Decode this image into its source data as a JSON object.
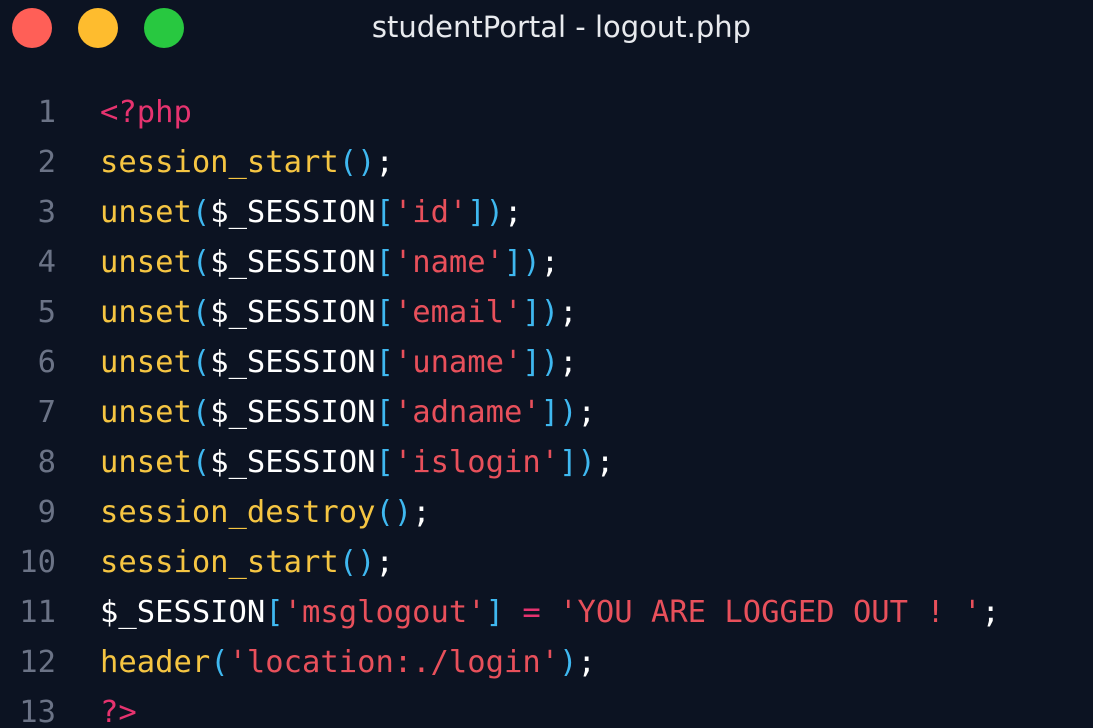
{
  "window": {
    "title": "studentPortal - logout.php",
    "buttons": [
      {
        "name": "close",
        "color": "#ff5f57"
      },
      {
        "name": "minimize",
        "color": "#febc2e"
      },
      {
        "name": "maximize",
        "color": "#28c840"
      }
    ]
  },
  "colors": {
    "keyword_tag": "#e6336f",
    "function": "#f5c542",
    "paren": "#3fb8f0",
    "default": "#ffffff",
    "string": "#e8505b",
    "operator": "#e6336f",
    "line_number": "#6b7386",
    "background": "#0c1322"
  },
  "code": {
    "lines": [
      {
        "number": "1",
        "tokens": [
          {
            "t": "<?php",
            "k": "tag"
          }
        ]
      },
      {
        "number": "2",
        "tokens": [
          {
            "t": "session_start",
            "k": "function"
          },
          {
            "t": "()",
            "k": "paren"
          },
          {
            "t": ";",
            "k": "default"
          }
        ]
      },
      {
        "number": "3",
        "tokens": [
          {
            "t": "unset",
            "k": "function"
          },
          {
            "t": "(",
            "k": "paren"
          },
          {
            "t": "$_SESSION",
            "k": "default"
          },
          {
            "t": "[",
            "k": "paren"
          },
          {
            "t": "'id'",
            "k": "string"
          },
          {
            "t": "])",
            "k": "paren"
          },
          {
            "t": ";",
            "k": "default"
          }
        ]
      },
      {
        "number": "4",
        "tokens": [
          {
            "t": "unset",
            "k": "function"
          },
          {
            "t": "(",
            "k": "paren"
          },
          {
            "t": "$_SESSION",
            "k": "default"
          },
          {
            "t": "[",
            "k": "paren"
          },
          {
            "t": "'name'",
            "k": "string"
          },
          {
            "t": "])",
            "k": "paren"
          },
          {
            "t": ";",
            "k": "default"
          }
        ]
      },
      {
        "number": "5",
        "tokens": [
          {
            "t": "unset",
            "k": "function"
          },
          {
            "t": "(",
            "k": "paren"
          },
          {
            "t": "$_SESSION",
            "k": "default"
          },
          {
            "t": "[",
            "k": "paren"
          },
          {
            "t": "'email'",
            "k": "string"
          },
          {
            "t": "])",
            "k": "paren"
          },
          {
            "t": ";",
            "k": "default"
          }
        ]
      },
      {
        "number": "6",
        "tokens": [
          {
            "t": "unset",
            "k": "function"
          },
          {
            "t": "(",
            "k": "paren"
          },
          {
            "t": "$_SESSION",
            "k": "default"
          },
          {
            "t": "[",
            "k": "paren"
          },
          {
            "t": "'uname'",
            "k": "string"
          },
          {
            "t": "])",
            "k": "paren"
          },
          {
            "t": ";",
            "k": "default"
          }
        ]
      },
      {
        "number": "7",
        "tokens": [
          {
            "t": "unset",
            "k": "function"
          },
          {
            "t": "(",
            "k": "paren"
          },
          {
            "t": "$_SESSION",
            "k": "default"
          },
          {
            "t": "[",
            "k": "paren"
          },
          {
            "t": "'adname'",
            "k": "string"
          },
          {
            "t": "])",
            "k": "paren"
          },
          {
            "t": ";",
            "k": "default"
          }
        ]
      },
      {
        "number": "8",
        "tokens": [
          {
            "t": "unset",
            "k": "function"
          },
          {
            "t": "(",
            "k": "paren"
          },
          {
            "t": "$_SESSION",
            "k": "default"
          },
          {
            "t": "[",
            "k": "paren"
          },
          {
            "t": "'islogin'",
            "k": "string"
          },
          {
            "t": "])",
            "k": "paren"
          },
          {
            "t": ";",
            "k": "default"
          }
        ]
      },
      {
        "number": "9",
        "tokens": [
          {
            "t": "session_destroy",
            "k": "function"
          },
          {
            "t": "()",
            "k": "paren"
          },
          {
            "t": ";",
            "k": "default"
          }
        ]
      },
      {
        "number": "10",
        "tokens": [
          {
            "t": "session_start",
            "k": "function"
          },
          {
            "t": "()",
            "k": "paren"
          },
          {
            "t": ";",
            "k": "default"
          }
        ]
      },
      {
        "number": "11",
        "tokens": [
          {
            "t": "$_SESSION",
            "k": "default"
          },
          {
            "t": "[",
            "k": "paren"
          },
          {
            "t": "'msglogout'",
            "k": "string"
          },
          {
            "t": "]",
            "k": "paren"
          },
          {
            "t": " ",
            "k": "default"
          },
          {
            "t": "=",
            "k": "operator"
          },
          {
            "t": " ",
            "k": "default"
          },
          {
            "t": "'YOU ARE LOGGED OUT ! '",
            "k": "string"
          },
          {
            "t": ";",
            "k": "default"
          }
        ]
      },
      {
        "number": "12",
        "tokens": [
          {
            "t": "header",
            "k": "function"
          },
          {
            "t": "(",
            "k": "paren"
          },
          {
            "t": "'location:./login'",
            "k": "string"
          },
          {
            "t": ")",
            "k": "paren"
          },
          {
            "t": ";",
            "k": "default"
          }
        ]
      },
      {
        "number": "13",
        "tokens": [
          {
            "t": "?>",
            "k": "tag"
          }
        ]
      }
    ]
  }
}
